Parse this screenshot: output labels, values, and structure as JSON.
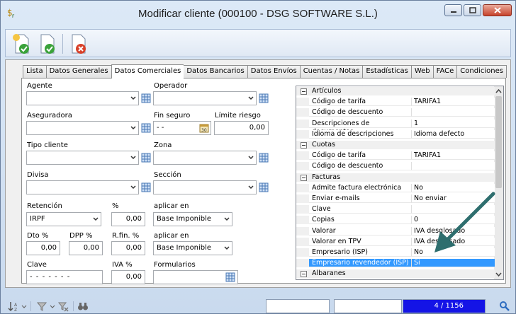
{
  "window": {
    "title": "Modificar cliente (000100 - DSG SOFTWARE S.L.)"
  },
  "tabs": [
    "Lista",
    "Datos Generales",
    "Datos Comerciales",
    "Datos Bancarios",
    "Datos Envíos",
    "Cuentas / Notas",
    "Estadísticas",
    "Web",
    "FACe",
    "Condiciones"
  ],
  "form": {
    "agente_label": "Agente",
    "operador_label": "Operador",
    "aseguradora_label": "Aseguradora",
    "fin_seguro_label": "Fin seguro",
    "fin_seguro_value": "- -",
    "limite_riesgo_label": "Límite riesgo",
    "limite_riesgo_value": "0,00",
    "tipo_cliente_label": "Tipo cliente",
    "zona_label": "Zona",
    "divisa_label": "Divisa",
    "seccion_label": "Sección",
    "retencion_label": "Retención",
    "retencion_value": "IRPF",
    "pct_label": "%",
    "pct_value": "0,00",
    "aplicar_en_label": "aplicar en",
    "aplicar_en_value": "Base Imponible",
    "dto_label": "Dto %",
    "dto_value": "0,00",
    "dpp_label": "DPP %",
    "dpp_value": "0,00",
    "rfin_label": "R.fin. %",
    "rfin_value": "0,00",
    "aplicar_en2_label": "aplicar en",
    "aplicar_en2_value": "Base Imponible",
    "clave_label": "Clave",
    "clave_value": "- - - - - - -",
    "iva_label": "IVA %",
    "iva_value": "0,00",
    "formularios_label": "Formularios"
  },
  "grid": [
    {
      "type": "cat",
      "name": "Artículos"
    },
    {
      "type": "prop",
      "name": "Código de tarifa",
      "value": "TARIFA1"
    },
    {
      "type": "prop",
      "name": "Código de descuento",
      "value": ""
    },
    {
      "type": "prop",
      "name": "Descripciones de documentos",
      "value": "1"
    },
    {
      "type": "prop",
      "name": "Idioma de descripciones",
      "value": "Idioma defecto"
    },
    {
      "type": "cat",
      "name": "Cuotas"
    },
    {
      "type": "prop",
      "name": "Código de tarifa",
      "value": "TARIFA1"
    },
    {
      "type": "prop",
      "name": "Código de descuento",
      "value": ""
    },
    {
      "type": "cat",
      "name": "Facturas"
    },
    {
      "type": "prop",
      "name": "Admite factura electrónica",
      "value": "No"
    },
    {
      "type": "prop",
      "name": "Enviar e-mails",
      "value": "No enviar"
    },
    {
      "type": "prop",
      "name": "Clave",
      "value": ""
    },
    {
      "type": "prop",
      "name": "Copias",
      "value": "0"
    },
    {
      "type": "prop",
      "name": "Valorar",
      "value": "IVA desglosado"
    },
    {
      "type": "prop",
      "name": "Valorar en TPV",
      "value": "IVA desglosado"
    },
    {
      "type": "prop",
      "name": "Empresario (ISP)",
      "value": "No"
    },
    {
      "type": "prop",
      "name": "Empresario revendedor (ISP)",
      "value": "Si",
      "selected": true
    },
    {
      "type": "cat",
      "name": "Albaranes"
    }
  ],
  "status": {
    "record": "4 / 1156"
  },
  "colors": {
    "accent": "#3399ff",
    "progress": "#1414e6",
    "arrow": "#2e6e6e"
  }
}
